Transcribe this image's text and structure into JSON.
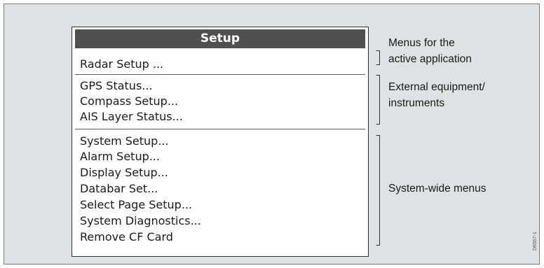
{
  "menu": {
    "title": "Setup",
    "items": [
      "Radar Setup ...",
      "GPS Status...",
      "Compass Setup...",
      "AIS Layer Status...",
      "System Setup...",
      "Alarm Setup...",
      "Display Setup...",
      "Databar Set...",
      "Select Page Setup...",
      "System Diagnostics...",
      "Remove CF Card"
    ]
  },
  "annotations": {
    "app_menus_line1": "Menus for the",
    "app_menus_line2": "active application",
    "external_line1": "External equipment/",
    "external_line2": "instruments",
    "system_wide": "System-wide menus"
  },
  "figure_ref": "D6557-1"
}
